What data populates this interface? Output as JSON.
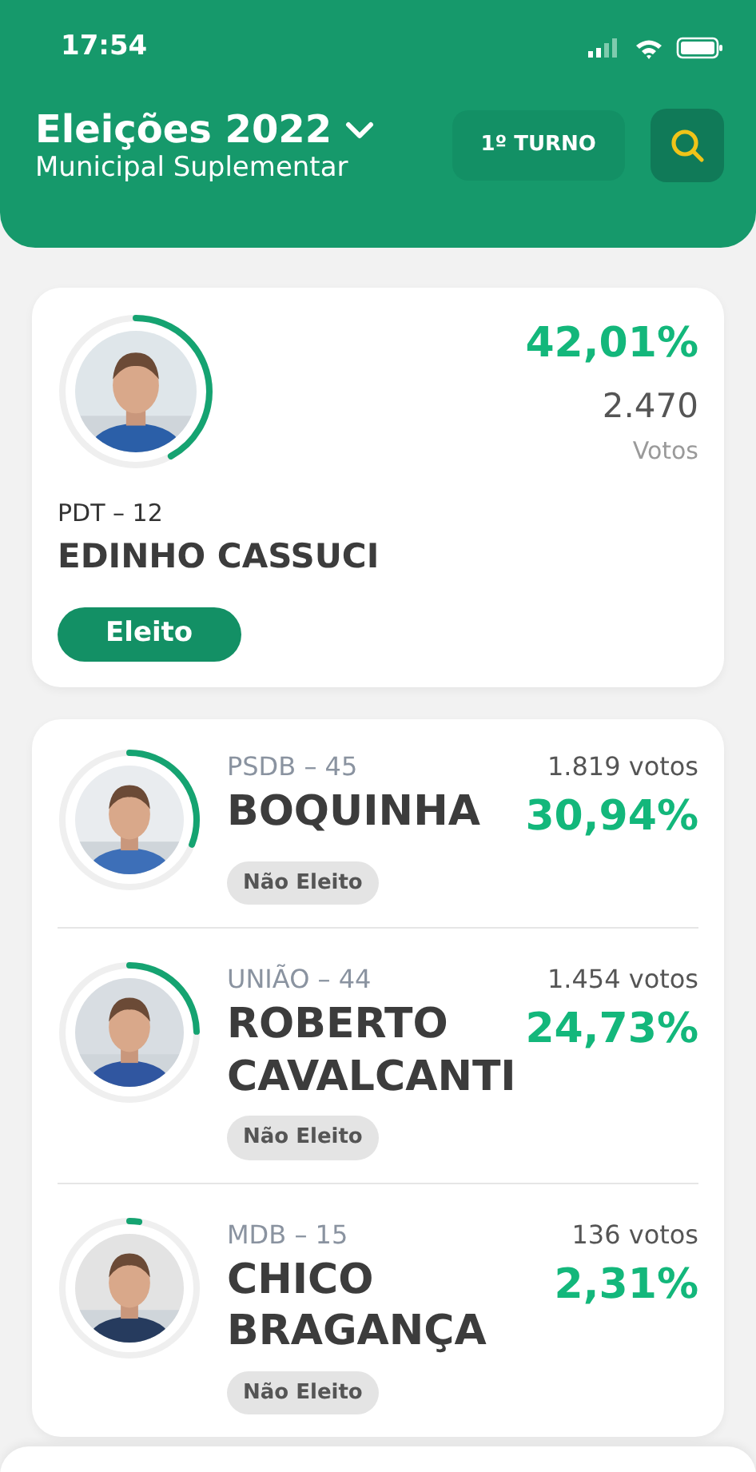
{
  "status_bar": {
    "time": "17:54"
  },
  "header": {
    "title": "Eleições 2022",
    "subtitle": "Municipal Suplementar",
    "round_button": "1º TURNO"
  },
  "winner": {
    "party": "PDT – 12",
    "name": "EDINHO CASSUCI",
    "percent": "42,01%",
    "votes": "2.470",
    "votes_label": "Votos",
    "status": "Eleito",
    "elected": true,
    "level": 0.4201
  },
  "candidates": [
    {
      "party": "PSDB – 45",
      "name": "BOQUINHA",
      "votes": "1.819 votos",
      "percent": "30,94%",
      "status": "Não Eleito",
      "elected": false,
      "level": 0.3094
    },
    {
      "party": "UNIÃO – 44",
      "name": "ROBERTO CAVALCANTI",
      "votes": "1.454 votos",
      "percent": "24,73%",
      "status": "Não Eleito",
      "elected": false,
      "level": 0.2473
    },
    {
      "party": "MDB – 15",
      "name": "CHICO BRAGANÇA",
      "votes": "136 votos",
      "percent": "2,31%",
      "status": "Não Eleito",
      "elected": false,
      "level": 0.0231
    }
  ]
}
